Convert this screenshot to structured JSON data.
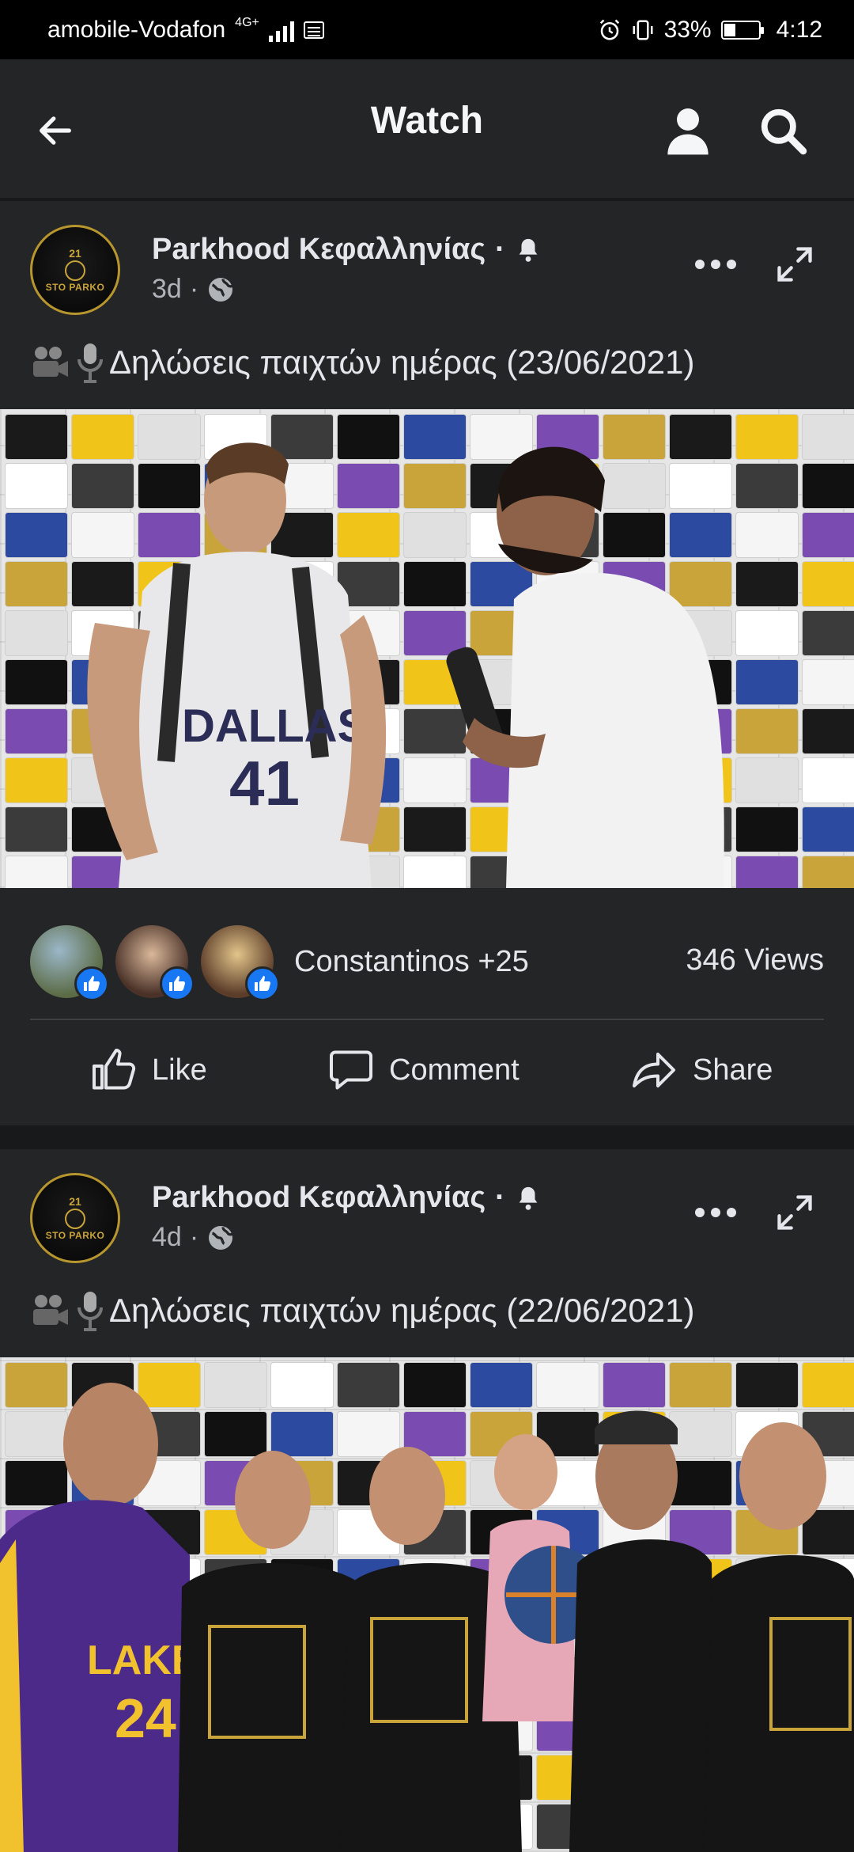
{
  "status_bar": {
    "carrier": "amobile-Vodafon",
    "network": "4G+",
    "battery": "33%",
    "time": "4:12"
  },
  "header": {
    "title": "Watch",
    "back_icon": "arrow-left-icon",
    "profile_icon": "person-icon",
    "search_icon": "search-icon"
  },
  "posts": [
    {
      "page_name": "Parkhood Κεφαλληνίας",
      "separator": "·",
      "time": "3d",
      "dot": "·",
      "caption": "Δηλώσεις παιχτών ημέρας (23/06/2021)",
      "reactions_text": "Constantinos +25",
      "views": "346 Views",
      "actions": {
        "like": "Like",
        "comment": "Comment",
        "share": "Share"
      }
    },
    {
      "page_name": "Parkhood Κεφαλληνίας",
      "separator": "·",
      "time": "4d",
      "dot": "·",
      "caption": "Δηλώσεις παιχτών ημέρας (22/06/2021)"
    }
  ],
  "avatar": {
    "number": "21",
    "brand": "STO PARKO"
  },
  "colors": {
    "accent": "#1877f2",
    "background": "#18191a",
    "card": "#242526",
    "gold": "#c9a43a"
  }
}
